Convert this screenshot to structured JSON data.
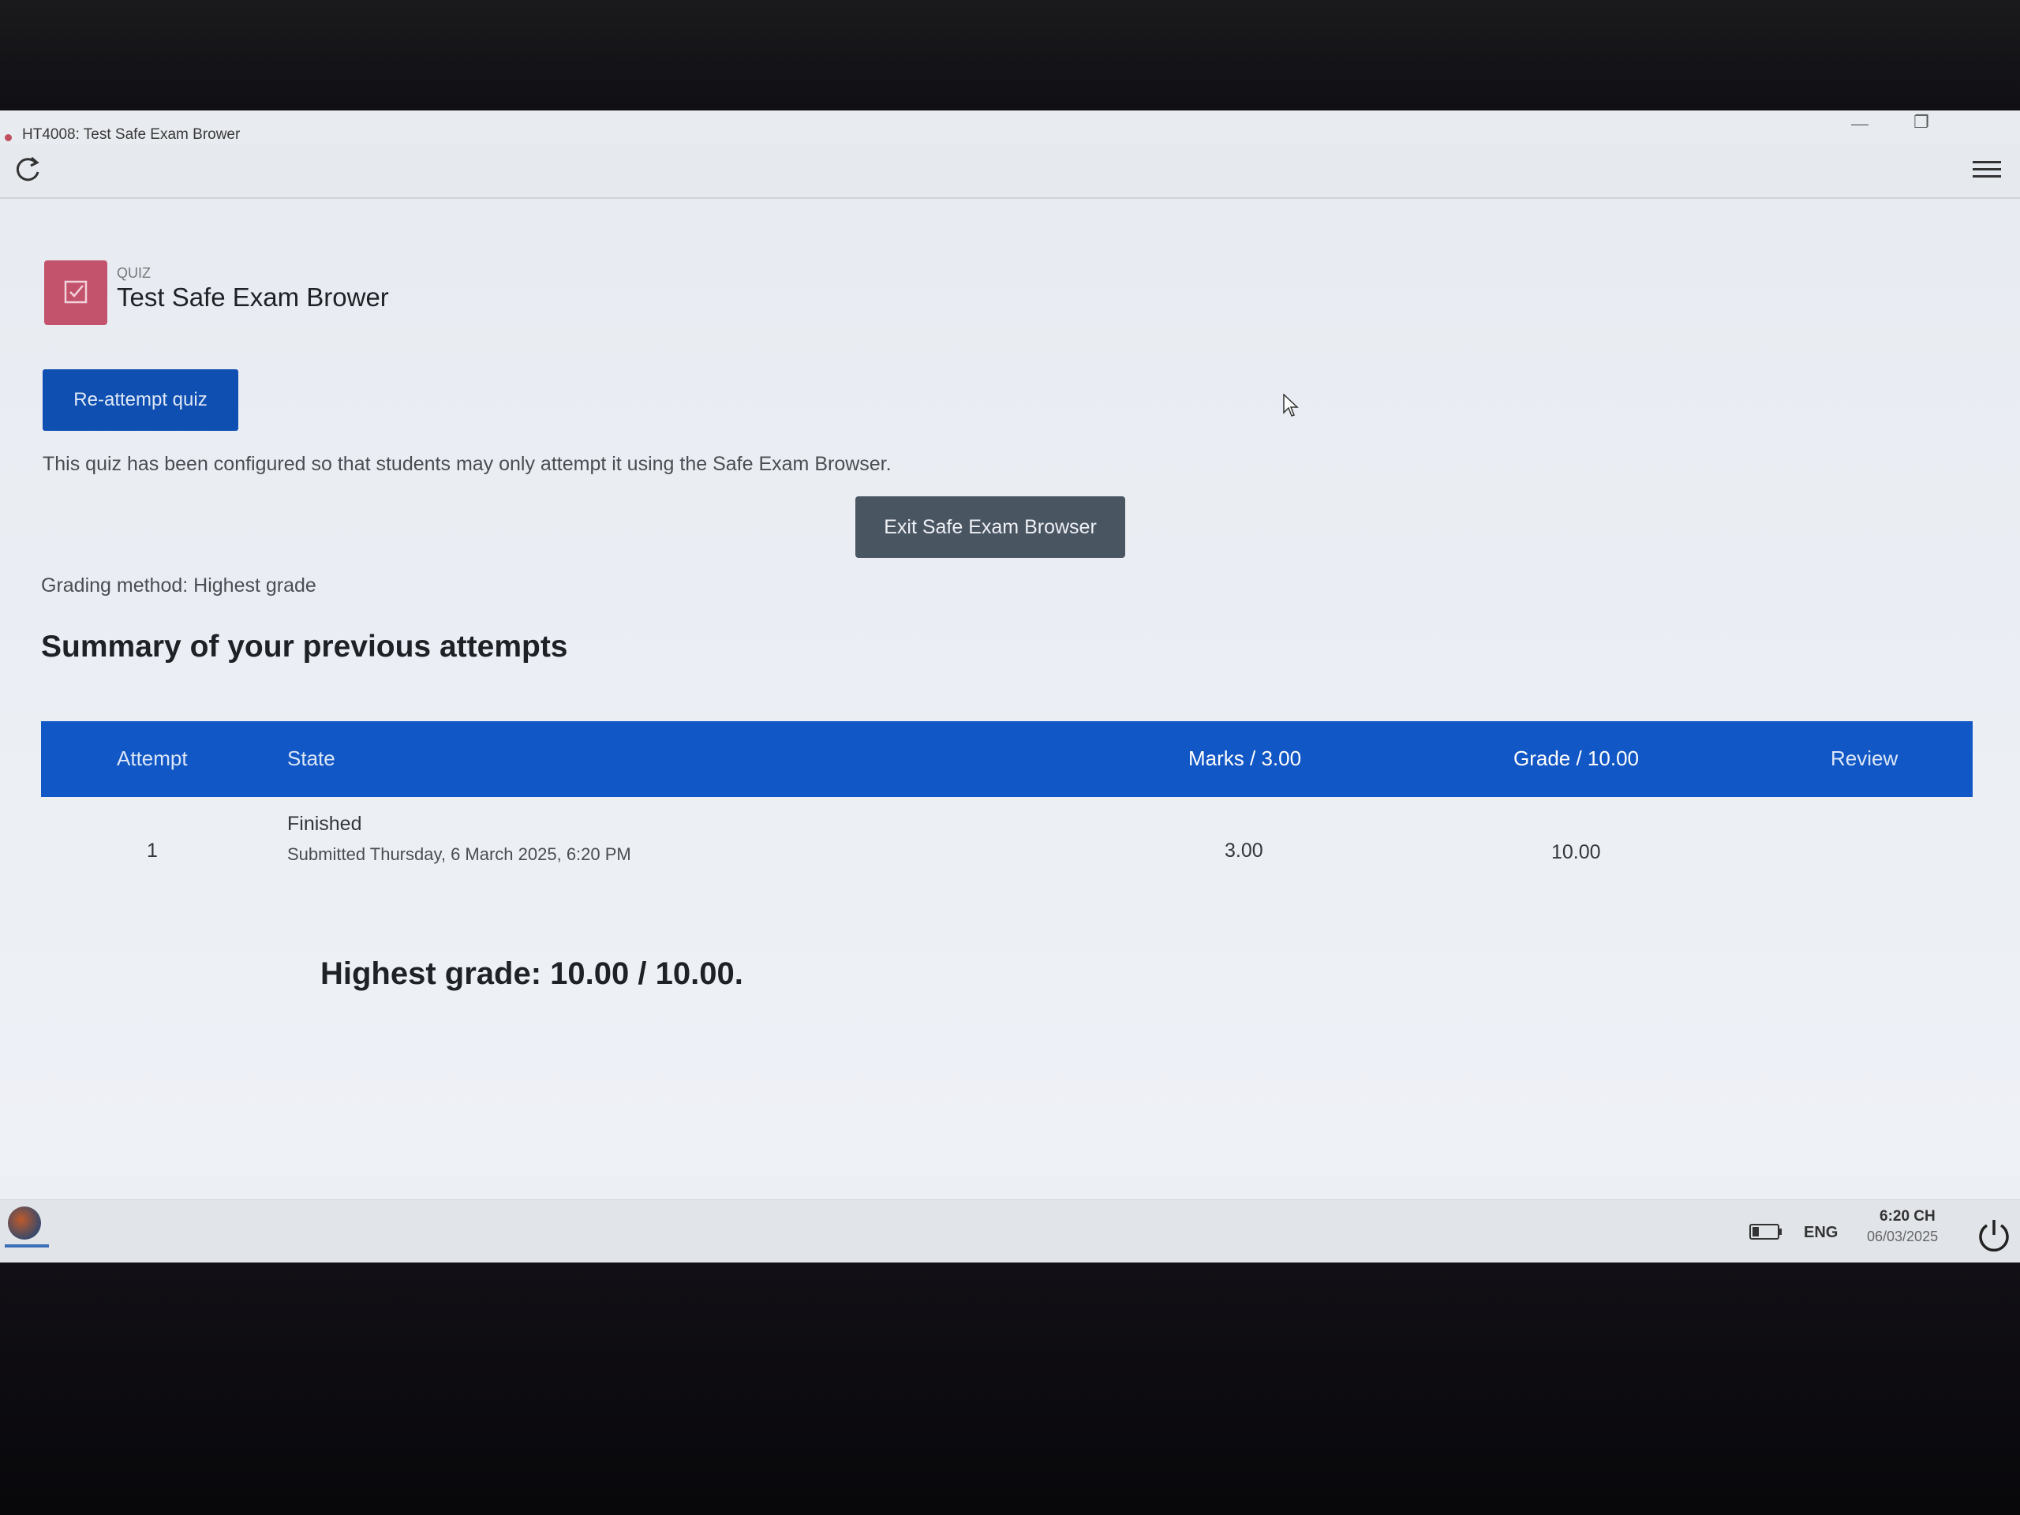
{
  "window": {
    "title": "HT4008: Test Safe Exam Brower",
    "minimize_glyph": "—",
    "restore_glyph": "❐"
  },
  "toolbar": {
    "reload_icon": "reload-icon",
    "menu_icon": "hamburger-menu-icon"
  },
  "quiz": {
    "label": "QUIZ",
    "title": "Test Safe Exam Brower",
    "icon_color": "#c3536d"
  },
  "actions": {
    "reattempt_label": "Re-attempt quiz",
    "exit_label": "Exit Safe Exam Browser"
  },
  "info_text": "This quiz has been configured so that students may only attempt it using the Safe Exam Browser.",
  "grading_method": "Grading method: Highest grade",
  "summary_heading": "Summary of your previous attempts",
  "attempts_table": {
    "header_color": "#1257c6",
    "columns": [
      "Attempt",
      "State",
      "Marks / 3.00",
      "Grade / 10.00",
      "Review"
    ],
    "rows": [
      {
        "attempt": "1",
        "state": "Finished",
        "submitted": "Submitted Thursday, 6 March 2025, 6:20 PM",
        "marks": "3.00",
        "grade": "10.00"
      }
    ]
  },
  "highest_grade": "Highest grade: 10.00 / 10.00.",
  "taskbar": {
    "language": "ENG",
    "time": "6:20 CH",
    "date": "06/03/2025"
  }
}
